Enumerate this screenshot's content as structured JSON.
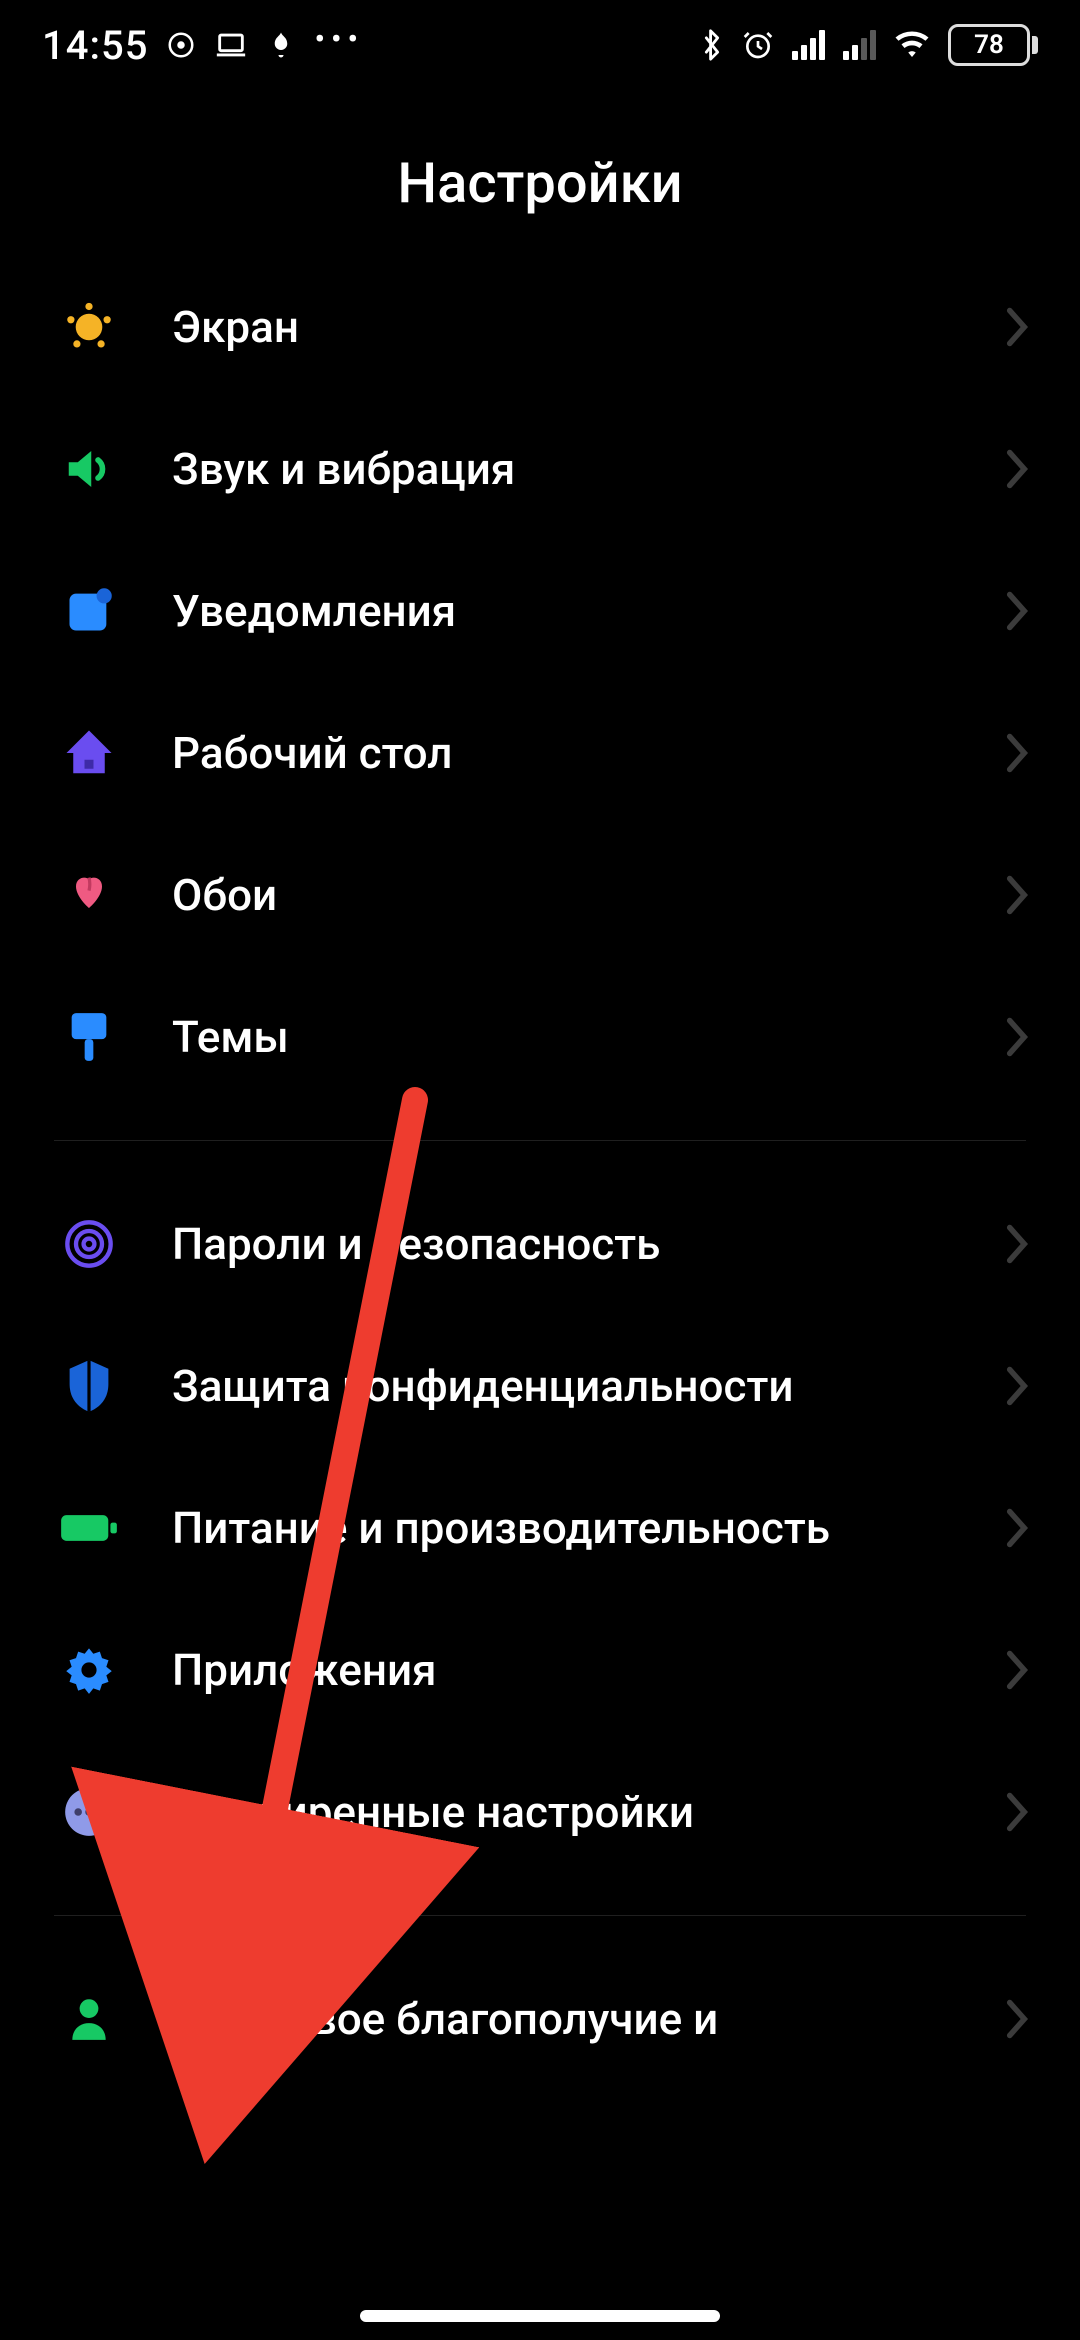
{
  "status": {
    "time": "14:55",
    "battery": "78"
  },
  "header": {
    "title": "Настройки"
  },
  "sections": [
    {
      "items": [
        {
          "icon": "display",
          "label": "Экран"
        },
        {
          "icon": "sound",
          "label": "Звук и вибрация"
        },
        {
          "icon": "notifications",
          "label": "Уведомления"
        },
        {
          "icon": "home",
          "label": "Рабочий стол"
        },
        {
          "icon": "wallpaper",
          "label": "Обои"
        },
        {
          "icon": "themes",
          "label": "Темы"
        }
      ]
    },
    {
      "items": [
        {
          "icon": "security",
          "label": "Пароли и безопасность"
        },
        {
          "icon": "privacy",
          "label": "Защита конфиденциальности"
        },
        {
          "icon": "battery",
          "label": "Питание и производительность"
        },
        {
          "icon": "apps",
          "label": "Приложения"
        },
        {
          "icon": "advanced",
          "label": "Расширенные настройки"
        }
      ]
    },
    {
      "items": [
        {
          "icon": "wellbeing",
          "label": "Цифровое благополучие и"
        }
      ]
    }
  ],
  "annotation": {
    "arrow_target": "Расширенные настройки"
  },
  "colors": {
    "display": "#f5b326",
    "sound": "#17c964",
    "notifications": "#2a8cff",
    "home": "#6a4df0",
    "wallpaper": "#ef5a82",
    "themes": "#2a8cff",
    "security": "#6a4df0",
    "privacy": "#1a64d8",
    "battery_icon": "#17c964",
    "apps": "#2a8cff",
    "advanced": "#8f9ae8",
    "wellbeing": "#17c964",
    "arrow": "#ee3c2f"
  }
}
